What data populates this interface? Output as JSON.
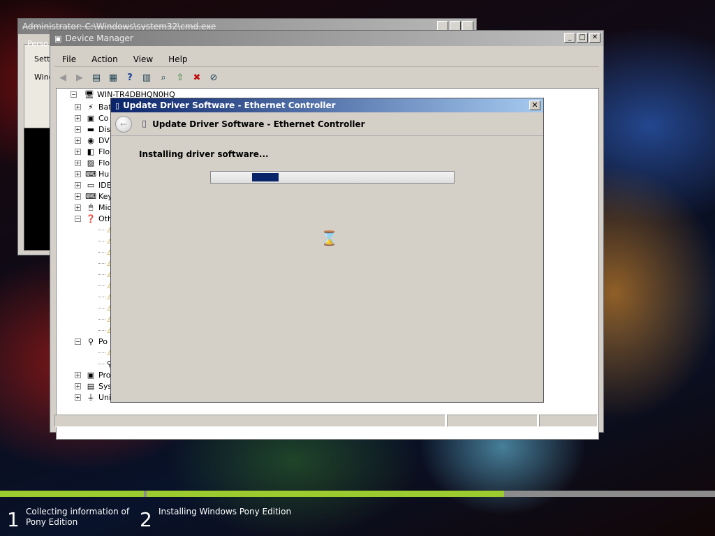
{
  "cmd_window": {
    "title": "Administrator: C:\\Windows\\system32\\cmd.exe",
    "personalize_title": "Perso",
    "lines": [
      "Settin",
      "Windo"
    ]
  },
  "device_manager": {
    "title": "Device Manager",
    "menu": [
      "File",
      "Action",
      "View",
      "Help"
    ],
    "toolbar_icons": [
      "back-icon",
      "forward-icon",
      "up-icon",
      "properties-icon",
      "help-icon",
      "view-icon",
      "scan-hardware-icon",
      "update-driver-icon",
      "uninstall-icon",
      "disable-icon"
    ],
    "root": "WIN-TR4DBHQN0HQ",
    "categories": [
      {
        "label": "Bat",
        "icon": "battery-icon"
      },
      {
        "label": "Co",
        "icon": "computer-icon"
      },
      {
        "label": "Dis",
        "icon": "disk-drive-icon"
      },
      {
        "label": "DV",
        "icon": "dvd-icon"
      },
      {
        "label": "Flo",
        "icon": "floppy-icon"
      },
      {
        "label": "Flo",
        "icon": "floppy-controller-icon"
      },
      {
        "label": "Hu",
        "icon": "hid-icon"
      },
      {
        "label": "IDE",
        "icon": "ide-icon"
      },
      {
        "label": "Key",
        "icon": "keyboard-icon"
      },
      {
        "label": "Mic",
        "icon": "mouse-icon"
      },
      {
        "label": "Oth",
        "icon": "other-devices-icon"
      }
    ],
    "other_children_count": 10,
    "ports": {
      "label": "Po",
      "icon": "port-icon"
    },
    "bottom_categories": [
      {
        "label": "Pro",
        "icon": "processor-icon"
      },
      {
        "label": "Sys",
        "icon": "system-icon"
      },
      {
        "label": "Uni",
        "icon": "usb-icon"
      }
    ]
  },
  "driver_dialog": {
    "title": "Update Driver Software - Ethernet Controller",
    "header": "Update Driver Software - Ethernet Controller",
    "message": "Installing driver software...",
    "progress_fraction": 0.11,
    "progress_offset": 0.17,
    "colors": {
      "titlebar": "#0a246a",
      "progress": "#0a246a"
    }
  },
  "setup": {
    "steps": [
      {
        "number": "1",
        "label_line1": "Collecting information of",
        "label_line2": "Pony Edition"
      },
      {
        "number": "2",
        "label_line1": "Installing Windows Pony Edition",
        "label_line2": ""
      }
    ],
    "accent": "#9ccb30"
  }
}
